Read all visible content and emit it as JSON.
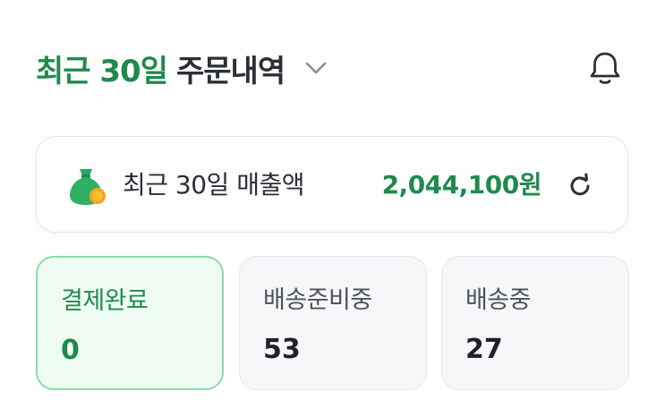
{
  "header": {
    "title_accent": "최근 30일",
    "title_main": "주문내역",
    "icons": {
      "chevron": "chevron-down-icon",
      "bell": "bell-icon"
    }
  },
  "sales": {
    "label": "최근 30일 매출액",
    "amount": "2,044,100원",
    "icons": {
      "money": "money-bag-icon",
      "refresh": "refresh-icon"
    }
  },
  "status": {
    "cards": [
      {
        "label": "결제완료",
        "count": "0",
        "active": true
      },
      {
        "label": "배송준비중",
        "count": "53",
        "active": false
      },
      {
        "label": "배송중",
        "count": "27",
        "active": false
      }
    ]
  },
  "colors": {
    "accent": "#1f8a4c",
    "text": "#2b2f36",
    "card_border": "#e3e6ea",
    "active_bg": "#effcf3",
    "active_border": "#8fd8ac",
    "inactive_bg": "#f6f7f9"
  }
}
